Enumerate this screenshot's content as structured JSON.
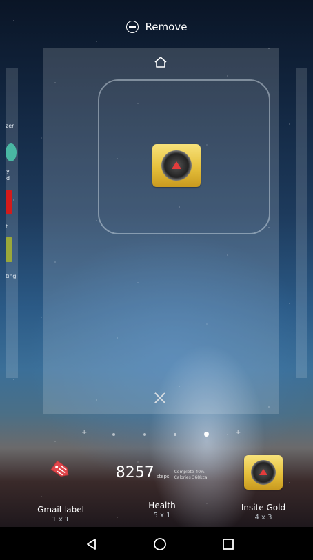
{
  "top_action": {
    "label": "Remove",
    "icon": "remove-circle-icon"
  },
  "left_panel_snippets": [
    "zer",
    "y",
    "d",
    "t",
    "ting"
  ],
  "center_panel": {
    "home_icon": "home-icon",
    "widget_preview_icon": "insite-gold-app-icon",
    "close_icon": "close-icon"
  },
  "page_indicator": {
    "count": 7,
    "active_index": 5,
    "last_is_add": true
  },
  "widgets": [
    {
      "id": "gmail",
      "name": "Gmail label",
      "size": "1 x 1",
      "icon": "gmail-label-tag-icon"
    },
    {
      "id": "health",
      "name": "Health",
      "size": "5 x 1",
      "preview": {
        "steps": "8257",
        "unit": "steps",
        "complete": "Complete 40%",
        "calories": "Calories 368kcal"
      }
    },
    {
      "id": "insite",
      "name": "Insite Gold",
      "size": "4 x 3",
      "icon": "insite-gold-app-icon"
    }
  ],
  "nav": {
    "back": "back-icon",
    "home": "home-circle-icon",
    "recents": "recents-square-icon"
  },
  "colors": {
    "accent_gold": "#e5bf3b",
    "tag_red": "#e0474c",
    "nav_bg": "#000000"
  }
}
